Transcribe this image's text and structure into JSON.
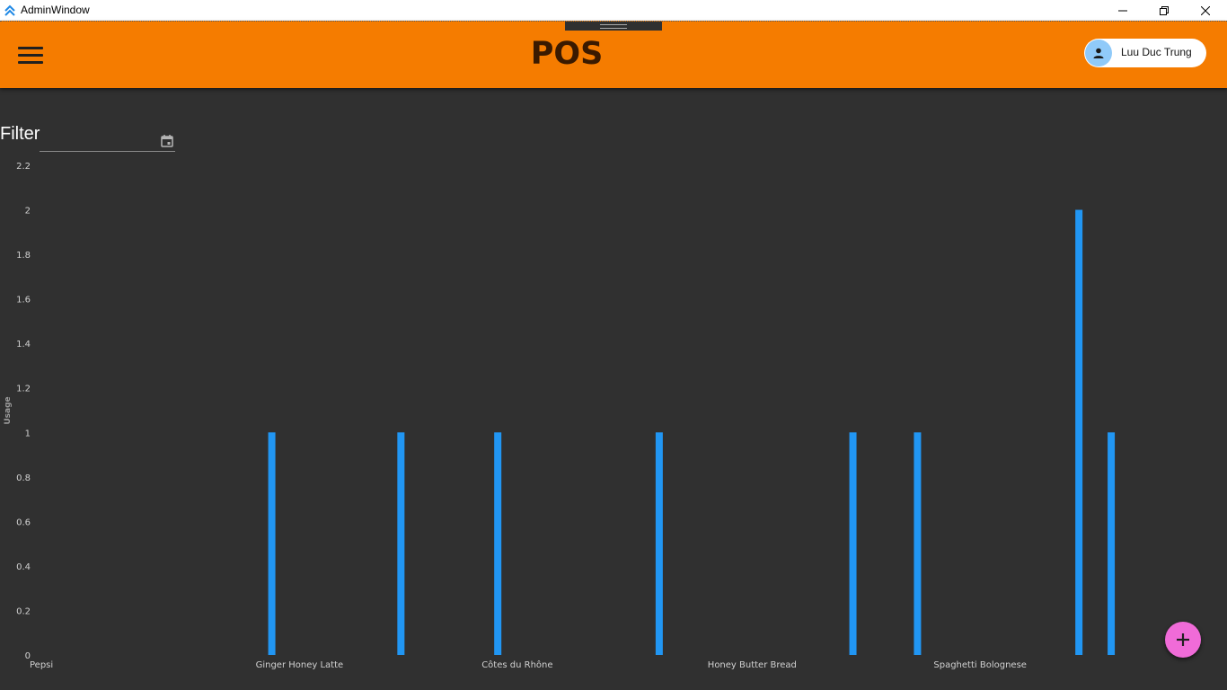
{
  "window": {
    "title": "AdminWindow"
  },
  "appbar": {
    "title": "POS",
    "user_name": "Luu Duc Trung",
    "accent_color": "#f57c00"
  },
  "filter": {
    "label": "Filter",
    "date_value": ""
  },
  "icons": {
    "app": "app-chevrons-icon",
    "menu": "hamburger-menu-icon",
    "avatar": "person-icon",
    "calendar": "calendar-icon",
    "fab": "plus-icon"
  },
  "chart_data": {
    "type": "bar",
    "xlabel": "",
    "ylabel": "Usage",
    "ylim": [
      0,
      2.2
    ],
    "yticks": [
      0,
      0.2,
      0.4,
      0.6,
      0.8,
      1,
      1.2,
      1.4,
      1.6,
      1.8,
      2,
      2.2
    ],
    "tick_labels": [
      "0",
      "0.2",
      "0.4",
      "0.6",
      "0.8",
      "1",
      "1.2",
      "1.4",
      "1.6",
      "1.8",
      "2",
      "2.2"
    ],
    "categories": [
      "Pepsi",
      "",
      "",
      "",
      "",
      "",
      "",
      "Ginger Honey Latte",
      "",
      "",
      "",
      "",
      "",
      "",
      "Côtes du Rhône",
      "",
      "",
      "",
      "",
      "",
      "",
      "Honey Butter Bread",
      "",
      "",
      "",
      "",
      "",
      "",
      "Spaghetti Bolognese",
      "",
      "",
      "",
      "",
      "",
      ""
    ],
    "values": [
      0,
      0,
      0,
      0,
      0,
      0,
      0,
      1,
      0,
      0,
      0,
      1,
      0,
      0,
      1,
      0,
      0,
      0,
      0,
      1,
      0,
      0,
      0,
      0,
      0,
      1,
      0,
      1,
      0,
      0,
      0,
      0,
      2,
      1,
      0
    ],
    "bar_color": "#2196f3",
    "grid": false
  }
}
